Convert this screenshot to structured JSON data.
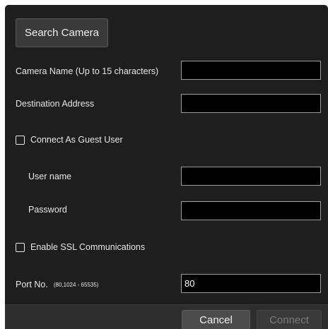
{
  "dialog": {
    "search_button": "Search Camera",
    "camera_name": {
      "label": "Camera Name  (Up to 15 characters)",
      "value": ""
    },
    "destination_address": {
      "label": "Destination Address",
      "value": ""
    },
    "guest_user": {
      "label": "Connect As Guest User",
      "checked": false
    },
    "user_name": {
      "label": "User name",
      "value": ""
    },
    "password": {
      "label": "Password",
      "value": ""
    },
    "ssl": {
      "label": "Enable SSL Communications",
      "checked": false
    },
    "port": {
      "label": "Port No.",
      "range_note": "(80,1024 - 65535)",
      "value": "80"
    }
  },
  "footer": {
    "cancel_label": "Cancel",
    "connect_label": "Connect"
  },
  "colors": {
    "dialog_background": "#1e1e1e",
    "field_background": "#000000",
    "field_border": "#9c9c9c",
    "text": "#e6e6e6",
    "disabled_text": "#7a7a7a"
  }
}
